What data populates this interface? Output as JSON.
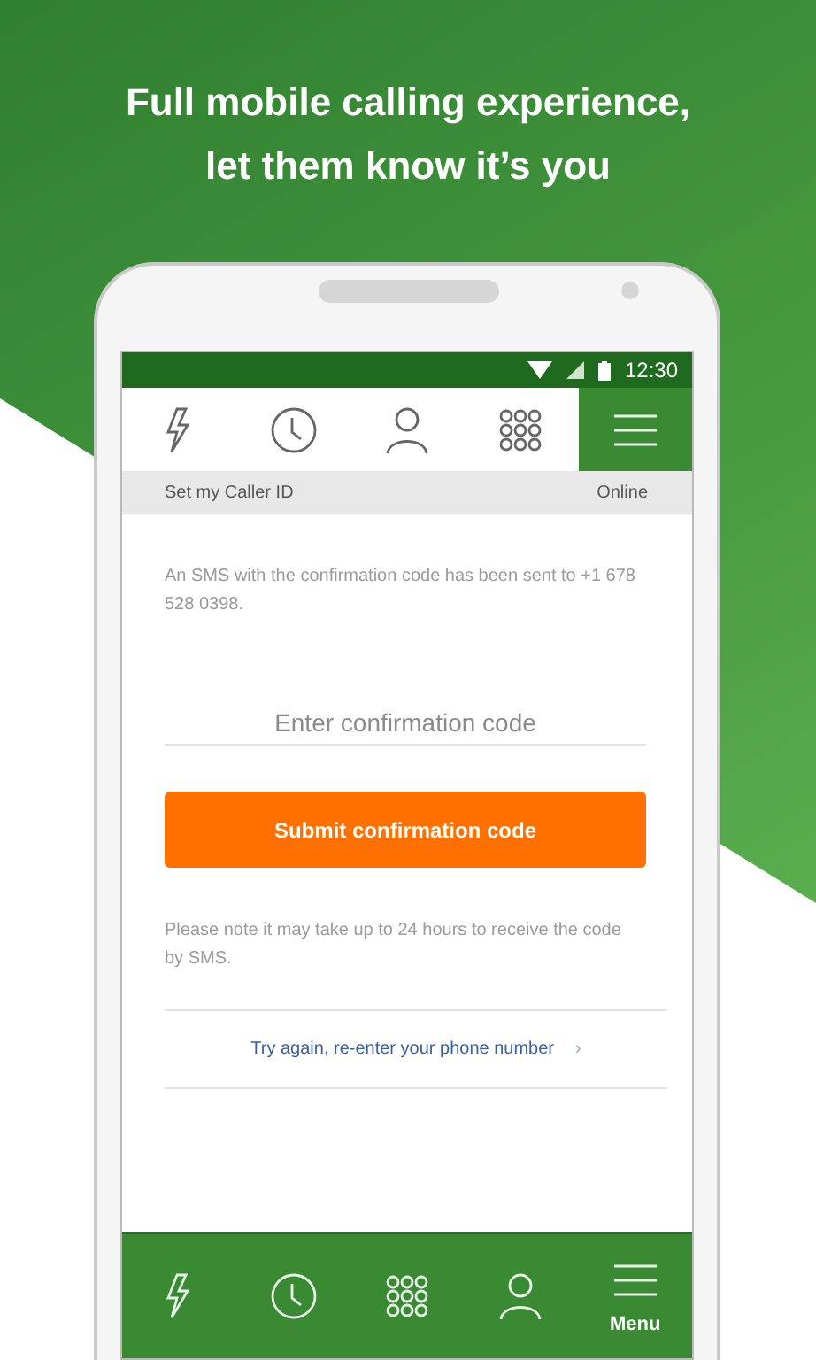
{
  "headline_lines": [
    "Full mobile calling experience,",
    "let them know it’s you"
  ],
  "status_bar": {
    "time": "12:30"
  },
  "top_tabs": [
    {
      "kind": "bolt",
      "selected": false
    },
    {
      "kind": "clock",
      "selected": false
    },
    {
      "kind": "person",
      "selected": false
    },
    {
      "kind": "dialpad",
      "selected": false
    },
    {
      "kind": "menu",
      "selected": true
    }
  ],
  "subheader": {
    "title": "Set my Caller ID",
    "status": "Online"
  },
  "message": "An SMS with the confirmation code has been sent to +1 678 528 0398.",
  "code_field": {
    "placeholder": "Enter confirmation code"
  },
  "submit_button": "Submit confirmation code",
  "note": "Please note it may take up to 24 hours to receive the code by SMS.",
  "retry_link": {
    "label": "Try again, re-enter your phone number",
    "chevron": "›"
  },
  "bottom_nav": [
    {
      "kind": "bolt"
    },
    {
      "kind": "clock"
    },
    {
      "kind": "dialpad"
    },
    {
      "kind": "person"
    },
    {
      "kind": "menu",
      "label": "Menu"
    }
  ]
}
